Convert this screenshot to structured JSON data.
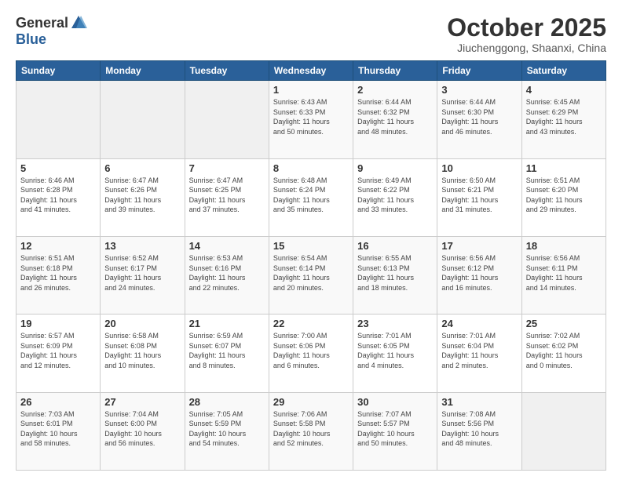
{
  "header": {
    "logo_general": "General",
    "logo_blue": "Blue",
    "month_title": "October 2025",
    "subtitle": "Jiuchenggong, Shaanxi, China"
  },
  "weekdays": [
    "Sunday",
    "Monday",
    "Tuesday",
    "Wednesday",
    "Thursday",
    "Friday",
    "Saturday"
  ],
  "weeks": [
    [
      {
        "day": "",
        "info": ""
      },
      {
        "day": "",
        "info": ""
      },
      {
        "day": "",
        "info": ""
      },
      {
        "day": "1",
        "info": "Sunrise: 6:43 AM\nSunset: 6:33 PM\nDaylight: 11 hours\nand 50 minutes."
      },
      {
        "day": "2",
        "info": "Sunrise: 6:44 AM\nSunset: 6:32 PM\nDaylight: 11 hours\nand 48 minutes."
      },
      {
        "day": "3",
        "info": "Sunrise: 6:44 AM\nSunset: 6:30 PM\nDaylight: 11 hours\nand 46 minutes."
      },
      {
        "day": "4",
        "info": "Sunrise: 6:45 AM\nSunset: 6:29 PM\nDaylight: 11 hours\nand 43 minutes."
      }
    ],
    [
      {
        "day": "5",
        "info": "Sunrise: 6:46 AM\nSunset: 6:28 PM\nDaylight: 11 hours\nand 41 minutes."
      },
      {
        "day": "6",
        "info": "Sunrise: 6:47 AM\nSunset: 6:26 PM\nDaylight: 11 hours\nand 39 minutes."
      },
      {
        "day": "7",
        "info": "Sunrise: 6:47 AM\nSunset: 6:25 PM\nDaylight: 11 hours\nand 37 minutes."
      },
      {
        "day": "8",
        "info": "Sunrise: 6:48 AM\nSunset: 6:24 PM\nDaylight: 11 hours\nand 35 minutes."
      },
      {
        "day": "9",
        "info": "Sunrise: 6:49 AM\nSunset: 6:22 PM\nDaylight: 11 hours\nand 33 minutes."
      },
      {
        "day": "10",
        "info": "Sunrise: 6:50 AM\nSunset: 6:21 PM\nDaylight: 11 hours\nand 31 minutes."
      },
      {
        "day": "11",
        "info": "Sunrise: 6:51 AM\nSunset: 6:20 PM\nDaylight: 11 hours\nand 29 minutes."
      }
    ],
    [
      {
        "day": "12",
        "info": "Sunrise: 6:51 AM\nSunset: 6:18 PM\nDaylight: 11 hours\nand 26 minutes."
      },
      {
        "day": "13",
        "info": "Sunrise: 6:52 AM\nSunset: 6:17 PM\nDaylight: 11 hours\nand 24 minutes."
      },
      {
        "day": "14",
        "info": "Sunrise: 6:53 AM\nSunset: 6:16 PM\nDaylight: 11 hours\nand 22 minutes."
      },
      {
        "day": "15",
        "info": "Sunrise: 6:54 AM\nSunset: 6:14 PM\nDaylight: 11 hours\nand 20 minutes."
      },
      {
        "day": "16",
        "info": "Sunrise: 6:55 AM\nSunset: 6:13 PM\nDaylight: 11 hours\nand 18 minutes."
      },
      {
        "day": "17",
        "info": "Sunrise: 6:56 AM\nSunset: 6:12 PM\nDaylight: 11 hours\nand 16 minutes."
      },
      {
        "day": "18",
        "info": "Sunrise: 6:56 AM\nSunset: 6:11 PM\nDaylight: 11 hours\nand 14 minutes."
      }
    ],
    [
      {
        "day": "19",
        "info": "Sunrise: 6:57 AM\nSunset: 6:09 PM\nDaylight: 11 hours\nand 12 minutes."
      },
      {
        "day": "20",
        "info": "Sunrise: 6:58 AM\nSunset: 6:08 PM\nDaylight: 11 hours\nand 10 minutes."
      },
      {
        "day": "21",
        "info": "Sunrise: 6:59 AM\nSunset: 6:07 PM\nDaylight: 11 hours\nand 8 minutes."
      },
      {
        "day": "22",
        "info": "Sunrise: 7:00 AM\nSunset: 6:06 PM\nDaylight: 11 hours\nand 6 minutes."
      },
      {
        "day": "23",
        "info": "Sunrise: 7:01 AM\nSunset: 6:05 PM\nDaylight: 11 hours\nand 4 minutes."
      },
      {
        "day": "24",
        "info": "Sunrise: 7:01 AM\nSunset: 6:04 PM\nDaylight: 11 hours\nand 2 minutes."
      },
      {
        "day": "25",
        "info": "Sunrise: 7:02 AM\nSunset: 6:02 PM\nDaylight: 11 hours\nand 0 minutes."
      }
    ],
    [
      {
        "day": "26",
        "info": "Sunrise: 7:03 AM\nSunset: 6:01 PM\nDaylight: 10 hours\nand 58 minutes."
      },
      {
        "day": "27",
        "info": "Sunrise: 7:04 AM\nSunset: 6:00 PM\nDaylight: 10 hours\nand 56 minutes."
      },
      {
        "day": "28",
        "info": "Sunrise: 7:05 AM\nSunset: 5:59 PM\nDaylight: 10 hours\nand 54 minutes."
      },
      {
        "day": "29",
        "info": "Sunrise: 7:06 AM\nSunset: 5:58 PM\nDaylight: 10 hours\nand 52 minutes."
      },
      {
        "day": "30",
        "info": "Sunrise: 7:07 AM\nSunset: 5:57 PM\nDaylight: 10 hours\nand 50 minutes."
      },
      {
        "day": "31",
        "info": "Sunrise: 7:08 AM\nSunset: 5:56 PM\nDaylight: 10 hours\nand 48 minutes."
      },
      {
        "day": "",
        "info": ""
      }
    ]
  ]
}
